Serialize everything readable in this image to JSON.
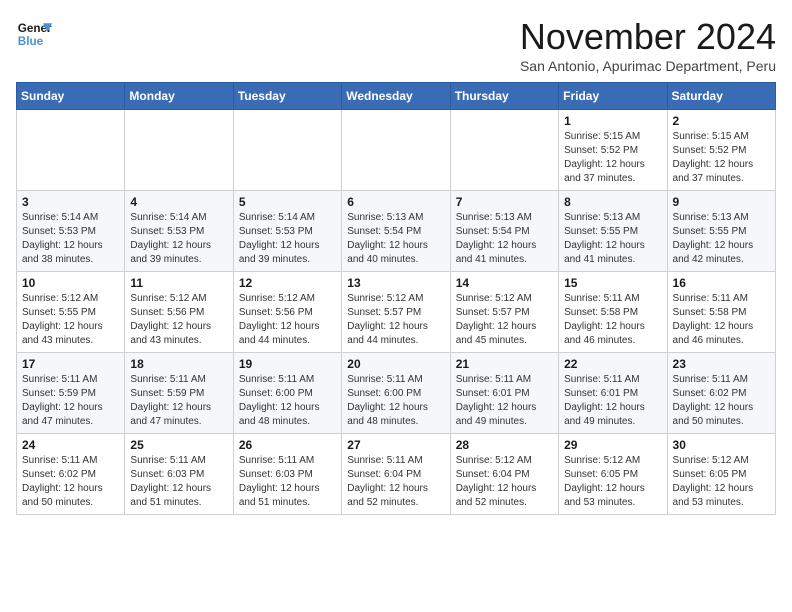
{
  "logo": {
    "line1": "General",
    "line2": "Blue"
  },
  "title": "November 2024",
  "subtitle": "San Antonio, Apurimac Department, Peru",
  "days_header": [
    "Sunday",
    "Monday",
    "Tuesday",
    "Wednesday",
    "Thursday",
    "Friday",
    "Saturday"
  ],
  "weeks": [
    [
      {
        "day": "",
        "info": ""
      },
      {
        "day": "",
        "info": ""
      },
      {
        "day": "",
        "info": ""
      },
      {
        "day": "",
        "info": ""
      },
      {
        "day": "",
        "info": ""
      },
      {
        "day": "1",
        "info": "Sunrise: 5:15 AM\nSunset: 5:52 PM\nDaylight: 12 hours\nand 37 minutes."
      },
      {
        "day": "2",
        "info": "Sunrise: 5:15 AM\nSunset: 5:52 PM\nDaylight: 12 hours\nand 37 minutes."
      }
    ],
    [
      {
        "day": "3",
        "info": "Sunrise: 5:14 AM\nSunset: 5:53 PM\nDaylight: 12 hours\nand 38 minutes."
      },
      {
        "day": "4",
        "info": "Sunrise: 5:14 AM\nSunset: 5:53 PM\nDaylight: 12 hours\nand 39 minutes."
      },
      {
        "day": "5",
        "info": "Sunrise: 5:14 AM\nSunset: 5:53 PM\nDaylight: 12 hours\nand 39 minutes."
      },
      {
        "day": "6",
        "info": "Sunrise: 5:13 AM\nSunset: 5:54 PM\nDaylight: 12 hours\nand 40 minutes."
      },
      {
        "day": "7",
        "info": "Sunrise: 5:13 AM\nSunset: 5:54 PM\nDaylight: 12 hours\nand 41 minutes."
      },
      {
        "day": "8",
        "info": "Sunrise: 5:13 AM\nSunset: 5:55 PM\nDaylight: 12 hours\nand 41 minutes."
      },
      {
        "day": "9",
        "info": "Sunrise: 5:13 AM\nSunset: 5:55 PM\nDaylight: 12 hours\nand 42 minutes."
      }
    ],
    [
      {
        "day": "10",
        "info": "Sunrise: 5:12 AM\nSunset: 5:55 PM\nDaylight: 12 hours\nand 43 minutes."
      },
      {
        "day": "11",
        "info": "Sunrise: 5:12 AM\nSunset: 5:56 PM\nDaylight: 12 hours\nand 43 minutes."
      },
      {
        "day": "12",
        "info": "Sunrise: 5:12 AM\nSunset: 5:56 PM\nDaylight: 12 hours\nand 44 minutes."
      },
      {
        "day": "13",
        "info": "Sunrise: 5:12 AM\nSunset: 5:57 PM\nDaylight: 12 hours\nand 44 minutes."
      },
      {
        "day": "14",
        "info": "Sunrise: 5:12 AM\nSunset: 5:57 PM\nDaylight: 12 hours\nand 45 minutes."
      },
      {
        "day": "15",
        "info": "Sunrise: 5:11 AM\nSunset: 5:58 PM\nDaylight: 12 hours\nand 46 minutes."
      },
      {
        "day": "16",
        "info": "Sunrise: 5:11 AM\nSunset: 5:58 PM\nDaylight: 12 hours\nand 46 minutes."
      }
    ],
    [
      {
        "day": "17",
        "info": "Sunrise: 5:11 AM\nSunset: 5:59 PM\nDaylight: 12 hours\nand 47 minutes."
      },
      {
        "day": "18",
        "info": "Sunrise: 5:11 AM\nSunset: 5:59 PM\nDaylight: 12 hours\nand 47 minutes."
      },
      {
        "day": "19",
        "info": "Sunrise: 5:11 AM\nSunset: 6:00 PM\nDaylight: 12 hours\nand 48 minutes."
      },
      {
        "day": "20",
        "info": "Sunrise: 5:11 AM\nSunset: 6:00 PM\nDaylight: 12 hours\nand 48 minutes."
      },
      {
        "day": "21",
        "info": "Sunrise: 5:11 AM\nSunset: 6:01 PM\nDaylight: 12 hours\nand 49 minutes."
      },
      {
        "day": "22",
        "info": "Sunrise: 5:11 AM\nSunset: 6:01 PM\nDaylight: 12 hours\nand 49 minutes."
      },
      {
        "day": "23",
        "info": "Sunrise: 5:11 AM\nSunset: 6:02 PM\nDaylight: 12 hours\nand 50 minutes."
      }
    ],
    [
      {
        "day": "24",
        "info": "Sunrise: 5:11 AM\nSunset: 6:02 PM\nDaylight: 12 hours\nand 50 minutes."
      },
      {
        "day": "25",
        "info": "Sunrise: 5:11 AM\nSunset: 6:03 PM\nDaylight: 12 hours\nand 51 minutes."
      },
      {
        "day": "26",
        "info": "Sunrise: 5:11 AM\nSunset: 6:03 PM\nDaylight: 12 hours\nand 51 minutes."
      },
      {
        "day": "27",
        "info": "Sunrise: 5:11 AM\nSunset: 6:04 PM\nDaylight: 12 hours\nand 52 minutes."
      },
      {
        "day": "28",
        "info": "Sunrise: 5:12 AM\nSunset: 6:04 PM\nDaylight: 12 hours\nand 52 minutes."
      },
      {
        "day": "29",
        "info": "Sunrise: 5:12 AM\nSunset: 6:05 PM\nDaylight: 12 hours\nand 53 minutes."
      },
      {
        "day": "30",
        "info": "Sunrise: 5:12 AM\nSunset: 6:05 PM\nDaylight: 12 hours\nand 53 minutes."
      }
    ]
  ]
}
